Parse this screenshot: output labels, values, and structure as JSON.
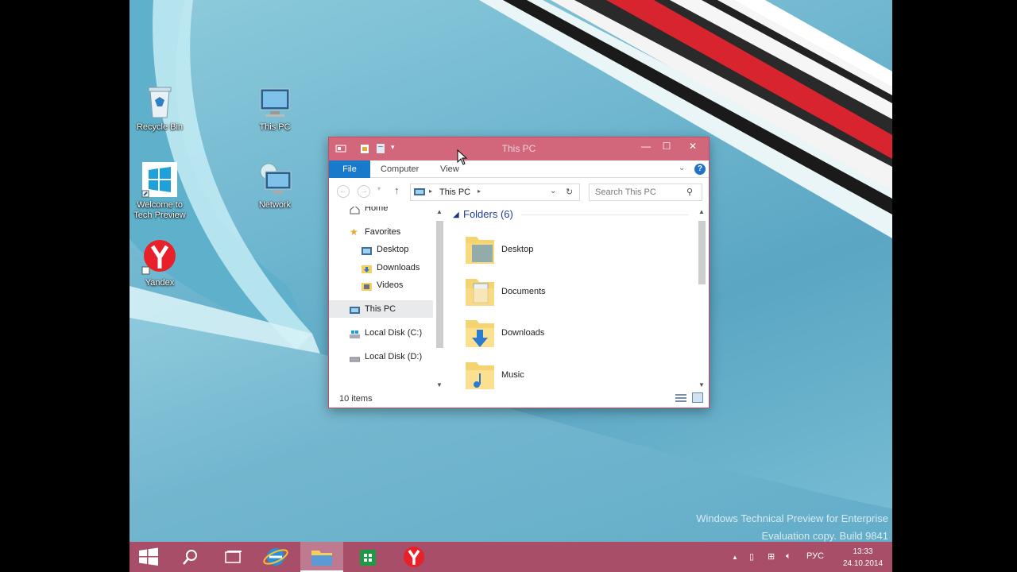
{
  "desktop": {
    "icons": [
      {
        "label": "Recycle Bin",
        "icon": "recycle-bin-icon"
      },
      {
        "label": "This PC",
        "icon": "computer-icon"
      },
      {
        "label": "Welcome to Tech Preview",
        "icon": "windows-logo-icon"
      },
      {
        "label": "Network",
        "icon": "network-icon"
      },
      {
        "label": "Yandex",
        "icon": "yandex-icon"
      }
    ],
    "watermark_line1": "Windows Technical Preview for Enterprise",
    "watermark_line2": "Evaluation copy. Build 9841"
  },
  "window": {
    "title": "This PC",
    "ribbon_tabs": [
      "File",
      "Computer",
      "View"
    ],
    "address_location": "This PC",
    "search_placeholder": "Search This PC",
    "nav": {
      "home": "Home",
      "favorites": "Favorites",
      "favorite_items": [
        "Desktop",
        "Downloads",
        "Videos"
      ],
      "this_pc": "This PC",
      "drives": [
        "Local Disk (C:)",
        "Local Disk (D:)"
      ]
    },
    "group_header": "Folders (6)",
    "folders": [
      "Desktop",
      "Documents",
      "Downloads",
      "Music"
    ],
    "status": "10 items",
    "colors": {
      "titlebar": "#d2677c",
      "file_tab": "#1979ca",
      "taskbar": "#ae455f"
    }
  },
  "taskbar": {
    "buttons": [
      "start-button",
      "search-button",
      "task-view-button",
      "internet-explorer",
      "file-explorer",
      "store",
      "yandex-browser"
    ],
    "language": "РУС",
    "time": "13:33",
    "date": "24.10.2014"
  }
}
